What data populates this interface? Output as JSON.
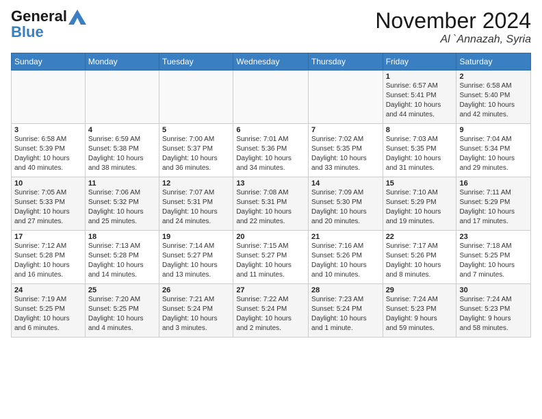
{
  "header": {
    "logo_line1": "General",
    "logo_line2": "Blue",
    "month_title": "November 2024",
    "location": "Al `Annazah, Syria"
  },
  "weekdays": [
    "Sunday",
    "Monday",
    "Tuesday",
    "Wednesday",
    "Thursday",
    "Friday",
    "Saturday"
  ],
  "weeks": [
    [
      {
        "day": "",
        "info": ""
      },
      {
        "day": "",
        "info": ""
      },
      {
        "day": "",
        "info": ""
      },
      {
        "day": "",
        "info": ""
      },
      {
        "day": "",
        "info": ""
      },
      {
        "day": "1",
        "info": "Sunrise: 6:57 AM\nSunset: 5:41 PM\nDaylight: 10 hours\nand 44 minutes."
      },
      {
        "day": "2",
        "info": "Sunrise: 6:58 AM\nSunset: 5:40 PM\nDaylight: 10 hours\nand 42 minutes."
      }
    ],
    [
      {
        "day": "3",
        "info": "Sunrise: 6:58 AM\nSunset: 5:39 PM\nDaylight: 10 hours\nand 40 minutes."
      },
      {
        "day": "4",
        "info": "Sunrise: 6:59 AM\nSunset: 5:38 PM\nDaylight: 10 hours\nand 38 minutes."
      },
      {
        "day": "5",
        "info": "Sunrise: 7:00 AM\nSunset: 5:37 PM\nDaylight: 10 hours\nand 36 minutes."
      },
      {
        "day": "6",
        "info": "Sunrise: 7:01 AM\nSunset: 5:36 PM\nDaylight: 10 hours\nand 34 minutes."
      },
      {
        "day": "7",
        "info": "Sunrise: 7:02 AM\nSunset: 5:35 PM\nDaylight: 10 hours\nand 33 minutes."
      },
      {
        "day": "8",
        "info": "Sunrise: 7:03 AM\nSunset: 5:35 PM\nDaylight: 10 hours\nand 31 minutes."
      },
      {
        "day": "9",
        "info": "Sunrise: 7:04 AM\nSunset: 5:34 PM\nDaylight: 10 hours\nand 29 minutes."
      }
    ],
    [
      {
        "day": "10",
        "info": "Sunrise: 7:05 AM\nSunset: 5:33 PM\nDaylight: 10 hours\nand 27 minutes."
      },
      {
        "day": "11",
        "info": "Sunrise: 7:06 AM\nSunset: 5:32 PM\nDaylight: 10 hours\nand 25 minutes."
      },
      {
        "day": "12",
        "info": "Sunrise: 7:07 AM\nSunset: 5:31 PM\nDaylight: 10 hours\nand 24 minutes."
      },
      {
        "day": "13",
        "info": "Sunrise: 7:08 AM\nSunset: 5:31 PM\nDaylight: 10 hours\nand 22 minutes."
      },
      {
        "day": "14",
        "info": "Sunrise: 7:09 AM\nSunset: 5:30 PM\nDaylight: 10 hours\nand 20 minutes."
      },
      {
        "day": "15",
        "info": "Sunrise: 7:10 AM\nSunset: 5:29 PM\nDaylight: 10 hours\nand 19 minutes."
      },
      {
        "day": "16",
        "info": "Sunrise: 7:11 AM\nSunset: 5:29 PM\nDaylight: 10 hours\nand 17 minutes."
      }
    ],
    [
      {
        "day": "17",
        "info": "Sunrise: 7:12 AM\nSunset: 5:28 PM\nDaylight: 10 hours\nand 16 minutes."
      },
      {
        "day": "18",
        "info": "Sunrise: 7:13 AM\nSunset: 5:28 PM\nDaylight: 10 hours\nand 14 minutes."
      },
      {
        "day": "19",
        "info": "Sunrise: 7:14 AM\nSunset: 5:27 PM\nDaylight: 10 hours\nand 13 minutes."
      },
      {
        "day": "20",
        "info": "Sunrise: 7:15 AM\nSunset: 5:27 PM\nDaylight: 10 hours\nand 11 minutes."
      },
      {
        "day": "21",
        "info": "Sunrise: 7:16 AM\nSunset: 5:26 PM\nDaylight: 10 hours\nand 10 minutes."
      },
      {
        "day": "22",
        "info": "Sunrise: 7:17 AM\nSunset: 5:26 PM\nDaylight: 10 hours\nand 8 minutes."
      },
      {
        "day": "23",
        "info": "Sunrise: 7:18 AM\nSunset: 5:25 PM\nDaylight: 10 hours\nand 7 minutes."
      }
    ],
    [
      {
        "day": "24",
        "info": "Sunrise: 7:19 AM\nSunset: 5:25 PM\nDaylight: 10 hours\nand 6 minutes."
      },
      {
        "day": "25",
        "info": "Sunrise: 7:20 AM\nSunset: 5:25 PM\nDaylight: 10 hours\nand 4 minutes."
      },
      {
        "day": "26",
        "info": "Sunrise: 7:21 AM\nSunset: 5:24 PM\nDaylight: 10 hours\nand 3 minutes."
      },
      {
        "day": "27",
        "info": "Sunrise: 7:22 AM\nSunset: 5:24 PM\nDaylight: 10 hours\nand 2 minutes."
      },
      {
        "day": "28",
        "info": "Sunrise: 7:23 AM\nSunset: 5:24 PM\nDaylight: 10 hours\nand 1 minute."
      },
      {
        "day": "29",
        "info": "Sunrise: 7:24 AM\nSunset: 5:23 PM\nDaylight: 9 hours\nand 59 minutes."
      },
      {
        "day": "30",
        "info": "Sunrise: 7:24 AM\nSunset: 5:23 PM\nDaylight: 9 hours\nand 58 minutes."
      }
    ]
  ]
}
